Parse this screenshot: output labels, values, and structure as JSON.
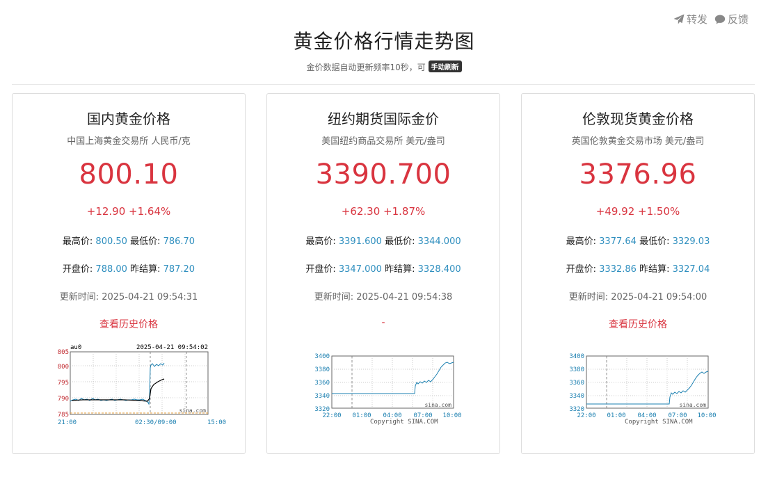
{
  "top_actions": {
    "share": "转发",
    "feedback": "反馈"
  },
  "page": {
    "title": "黄金价格行情走势图",
    "subtitle": "金价数据自动更新频率10秒，可",
    "refresh_label": "手动刷新"
  },
  "labels": {
    "high": "最高价:",
    "low": "最低价:",
    "open": "开盘价:",
    "prev": "昨结算:",
    "update": "更新时间:"
  },
  "cards": [
    {
      "title": "国内黄金价格",
      "source": "中国上海黄金交易所 人民币/克",
      "price": "800.10",
      "change": "+12.90 +1.64%",
      "high": "800.50",
      "low": "786.70",
      "open": "788.00",
      "prev": "787.20",
      "update_time": "2025-04-21 09:54:31",
      "link": "查看历史价格"
    },
    {
      "title": "纽约期货国际金价",
      "source": "美国纽约商品交易所 美元/盎司",
      "price": "3390.700",
      "change": "+62.30 +1.87%",
      "high": "3391.600",
      "low": "3344.000",
      "open": "3347.000",
      "prev": "3328.400",
      "update_time": "2025-04-21 09:54:38",
      "link": "-"
    },
    {
      "title": "伦敦现货黄金价格",
      "source": "英国伦敦黄金交易市场 美元/盎司",
      "price": "3376.96",
      "change": "+49.92 +1.50%",
      "high": "3377.64",
      "low": "3329.03",
      "open": "3332.86",
      "prev": "3327.04",
      "update_time": "2025-04-21 09:54:00",
      "link": "查看历史价格"
    }
  ],
  "charts": {
    "sge": {
      "symbol": "au0",
      "timestamp": "2025-04-21 09:54:02",
      "y_ticks": [
        "805",
        "800",
        "795",
        "790",
        "785"
      ],
      "x_ticks": [
        "21:00",
        "02:30/09:00",
        "15:00"
      ],
      "watermark": "sina.com"
    },
    "comex": {
      "y_ticks": [
        "3400",
        "3380",
        "3360",
        "3340",
        "3320"
      ],
      "x_ticks": [
        "22:00",
        "01:00",
        "04:00",
        "07:00",
        "10:00"
      ],
      "watermark": "sina.com",
      "copyright": "Copyright  SINA.COM"
    },
    "london": {
      "y_ticks": [
        "3400",
        "3380",
        "3360",
        "3340",
        "3320"
      ],
      "x_ticks": [
        "22:00",
        "01:00",
        "04:00",
        "07:00",
        "10:00"
      ],
      "watermark": "sina.com",
      "copyright": "Copyright  SINA.COM"
    }
  },
  "colors": {
    "accent_red": "#d9343f",
    "value_blue": "#2f8fbf",
    "chart_line": "#1a7fb0"
  }
}
